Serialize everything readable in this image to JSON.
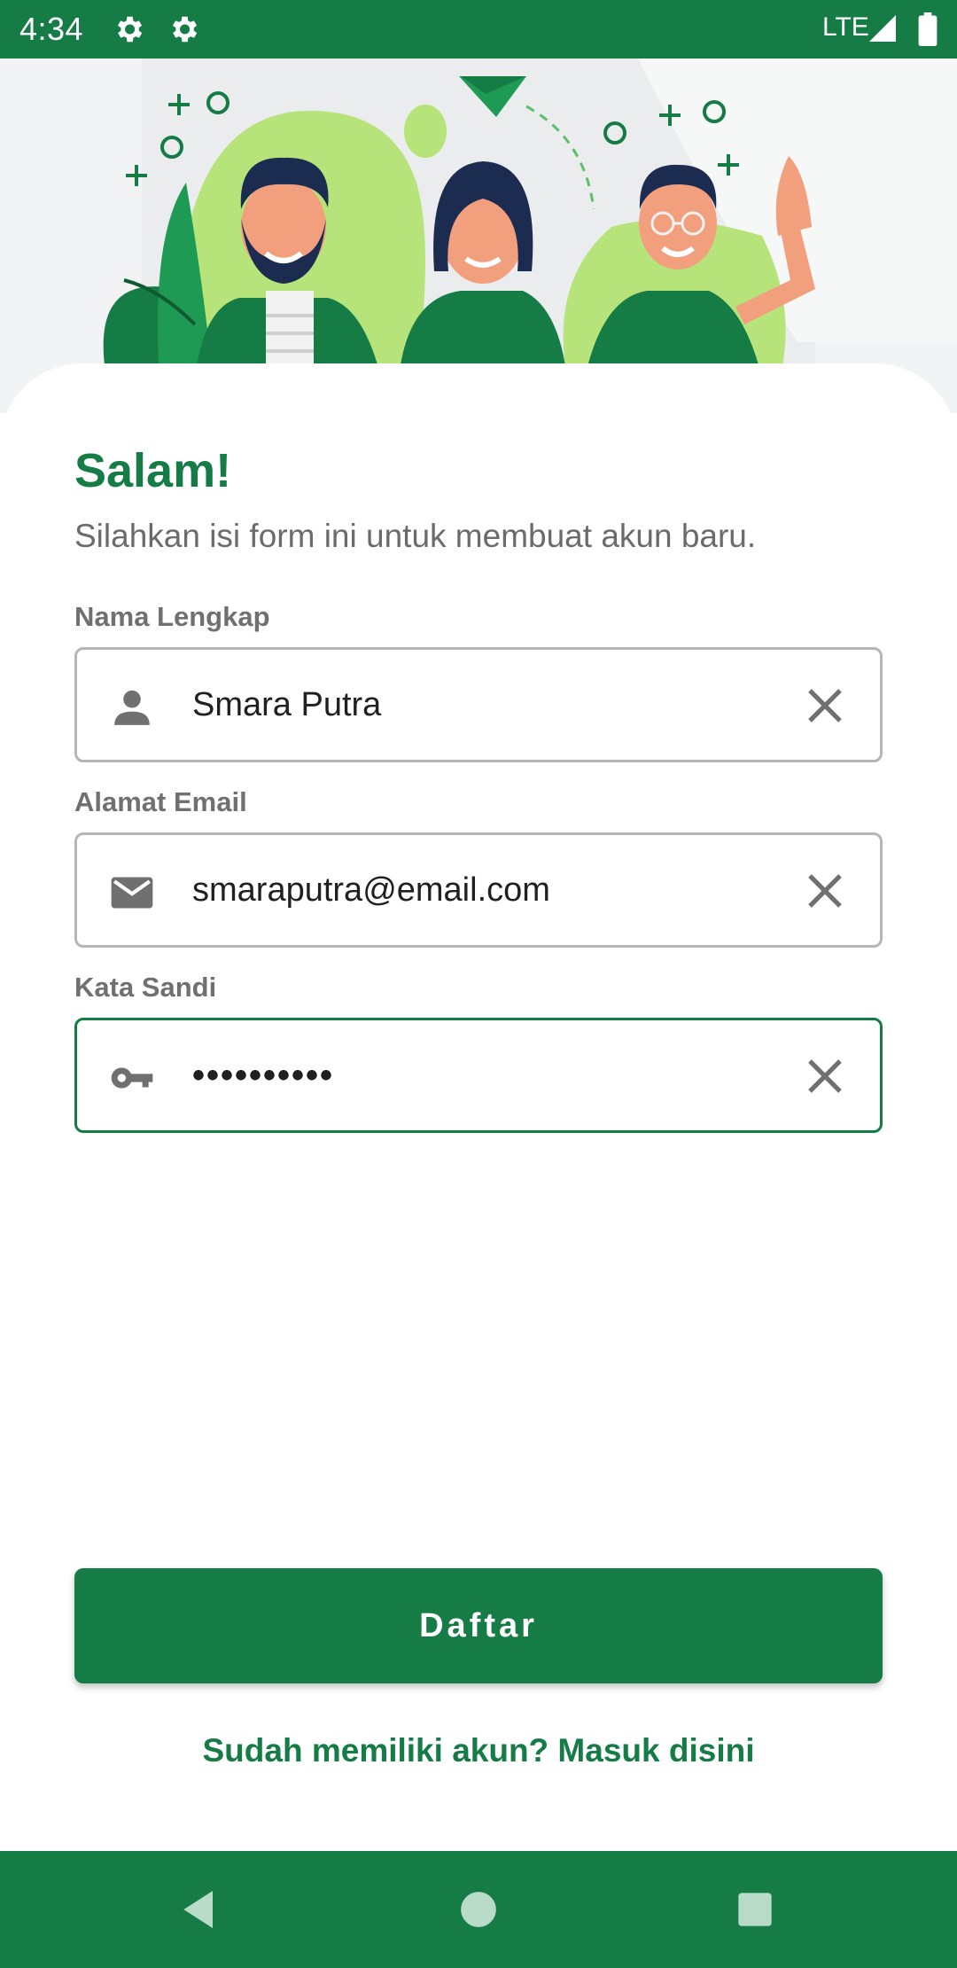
{
  "status_bar": {
    "time": "4:34",
    "network": "LTE",
    "icons": [
      "gear-icon",
      "gear-icon",
      "signal-icon",
      "battery-icon"
    ]
  },
  "hero": {
    "illustration": "three people waving illustration"
  },
  "form": {
    "greeting": "Salam!",
    "subtitle": "Silahkan isi form ini untuk membuat akun baru.",
    "name": {
      "label": "Nama Lengkap",
      "value": "Smara Putra",
      "icon": "person-icon"
    },
    "email": {
      "label": "Alamat Email",
      "value": "smaraputra@email.com",
      "icon": "mail-icon"
    },
    "password": {
      "label": "Kata Sandi",
      "value": "••••••••••",
      "icon": "key-icon"
    },
    "submit_label": "Daftar",
    "login_link": "Sudah memiliki akun? Masuk disini"
  },
  "colors": {
    "primary": "#167c46",
    "accent_light": "#b7e47a",
    "label_gray": "#707070"
  },
  "nav_bar": {
    "buttons": [
      "back-icon",
      "home-icon",
      "recents-icon"
    ]
  }
}
